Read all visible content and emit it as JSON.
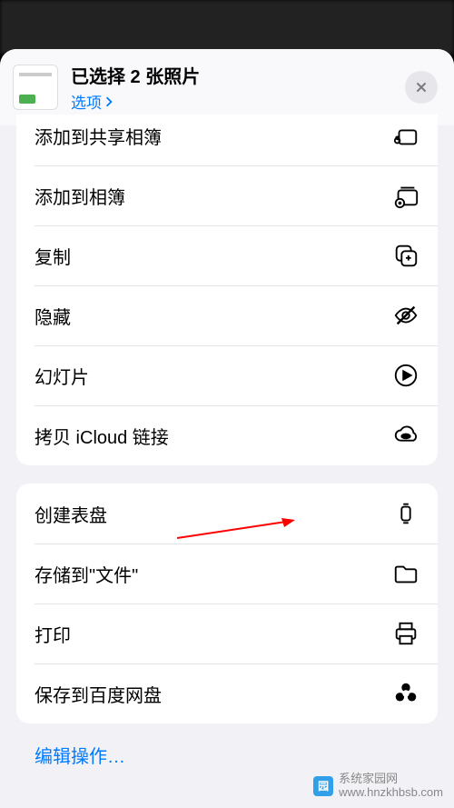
{
  "header": {
    "title": "已选择 2 张照片",
    "options_label": "选项"
  },
  "group1": {
    "add_shared_album": "添加到共享相簿",
    "add_album": "添加到相簿",
    "copy": "复制",
    "hide": "隐藏",
    "slideshow": "幻灯片",
    "icloud_link": "拷贝 iCloud 链接"
  },
  "group2": {
    "watch_face": "创建表盘",
    "save_files": "存储到\"文件\"",
    "print": "打印",
    "baidu": "保存到百度网盘"
  },
  "edit": "编辑操作…",
  "watermark": {
    "name": "系统家园网",
    "url": "www.hnzkhbsb.com"
  }
}
